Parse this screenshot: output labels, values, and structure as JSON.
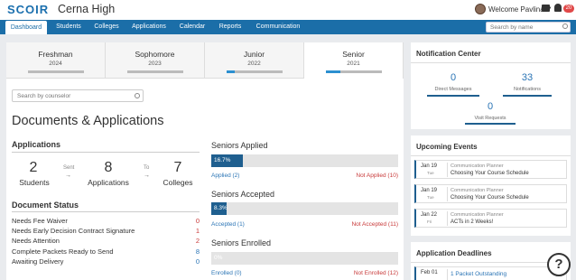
{
  "header": {
    "logo": "SCOIR",
    "school": "Cerna High",
    "welcome": "Welcome Pavlina",
    "notif_count": "20"
  },
  "nav": {
    "tabs": [
      {
        "label": "Dashboard",
        "active": true
      },
      {
        "label": "Students"
      },
      {
        "label": "Colleges"
      },
      {
        "label": "Applications"
      },
      {
        "label": "Calendar"
      },
      {
        "label": "Reports"
      },
      {
        "label": "Communication"
      }
    ],
    "search_placeholder": "Search by name"
  },
  "grades": [
    {
      "name": "Freshman",
      "year": "2024",
      "progress": 0
    },
    {
      "name": "Sophomore",
      "year": "2023",
      "progress": 0
    },
    {
      "name": "Junior",
      "year": "2022",
      "progress": 0.15
    },
    {
      "name": "Senior",
      "year": "2021",
      "progress": 0.25,
      "active": true
    }
  ],
  "counselor_placeholder": "Search by counselor",
  "main_title": "Documents & Applications",
  "applications": {
    "title": "Applications",
    "students_num": "2",
    "students_label": "Students",
    "sent_label": "Sent",
    "applications_num": "8",
    "applications_label": "Applications",
    "to_label": "To",
    "colleges_num": "7",
    "colleges_label": "Colleges"
  },
  "document_status": {
    "title": "Document Status",
    "rows": [
      {
        "label": "Needs Fee Waiver",
        "value": "0",
        "color": "#c83a3a"
      },
      {
        "label": "Needs Early Decision Contract Signature",
        "value": "1",
        "color": "#c83a3a"
      },
      {
        "label": "Needs Attention",
        "value": "2",
        "color": "#c83a3a"
      },
      {
        "label": "Complete Packets Ready to Send",
        "value": "8",
        "color": "#2a74b5"
      },
      {
        "label": "Awaiting Delivery",
        "value": "0",
        "color": "#2a74b5"
      }
    ]
  },
  "seniors": [
    {
      "title": "Seniors Applied",
      "pct_label": "16.7%",
      "pct": 0.167,
      "left": "Applied (2)",
      "right": "Not Applied (10)"
    },
    {
      "title": "Seniors Accepted",
      "pct_label": "8.3%",
      "pct": 0.083,
      "left": "Accepted (1)",
      "right": "Not Accepted (11)"
    },
    {
      "title": "Seniors Enrolled",
      "pct_label": "0%",
      "pct": 0,
      "left": "Enrolled (0)",
      "right": "Not Enrolled (12)"
    }
  ],
  "notification_center": {
    "title": "Notification Center",
    "direct_num": "0",
    "direct_label": "Direct Messages",
    "notif_num": "33",
    "notif_label": "Notifications",
    "visit_num": "0",
    "visit_label": "Visit Requests"
  },
  "events": {
    "title": "Upcoming Events",
    "items": [
      {
        "date": "Jan 19",
        "day": "Tue",
        "type": "Communication Planner",
        "name": "Choosing Your Course Schedule"
      },
      {
        "date": "Jan 19",
        "day": "Tue",
        "type": "Communication Planner",
        "name": "Choosing Your Course Schedule"
      },
      {
        "date": "Jan 22",
        "day": "Fri",
        "type": "Communication Planner",
        "name": "ACTs in 2 Weeks!"
      }
    ]
  },
  "deadlines": {
    "title": "Application Deadlines",
    "date": "Feb 01",
    "text": "1 Packet Outstanding"
  },
  "help_label": "?"
}
